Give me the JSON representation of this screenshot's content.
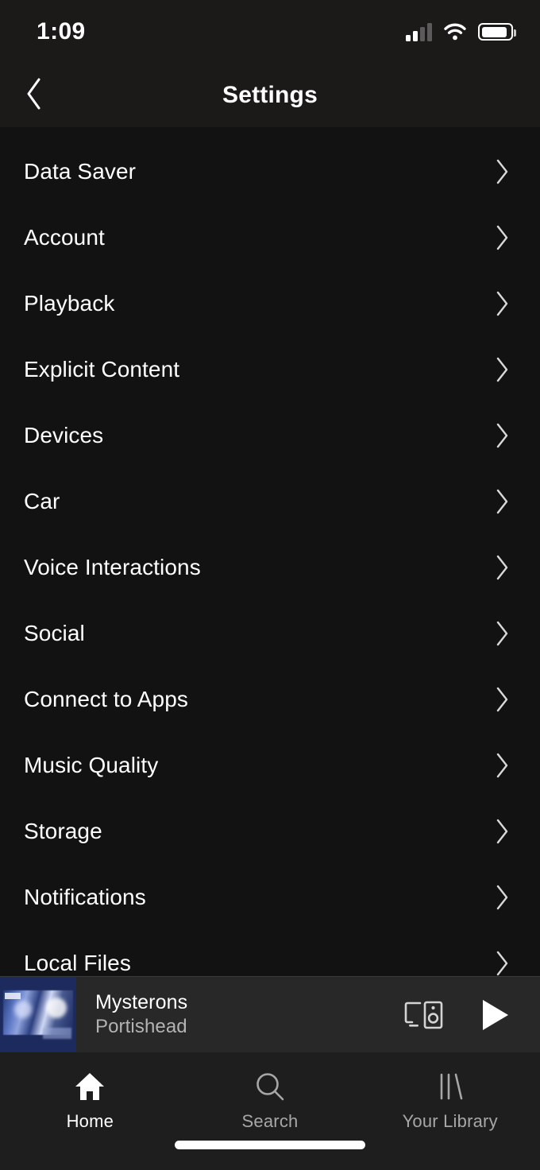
{
  "status_bar": {
    "time": "1:09",
    "signal_icon": "cellular-signal-icon",
    "signal_bars_total": 4,
    "signal_bars_filled": 2,
    "wifi_icon": "wifi-icon",
    "battery_icon": "battery-icon",
    "battery_level_percent": 90
  },
  "header": {
    "back_icon": "chevron-left-icon",
    "title": "Settings"
  },
  "settings": {
    "items": [
      {
        "label": "Data Saver",
        "chevron": "chevron-right-icon"
      },
      {
        "label": "Account",
        "chevron": "chevron-right-icon"
      },
      {
        "label": "Playback",
        "chevron": "chevron-right-icon"
      },
      {
        "label": "Explicit Content",
        "chevron": "chevron-right-icon"
      },
      {
        "label": "Devices",
        "chevron": "chevron-right-icon"
      },
      {
        "label": "Car",
        "chevron": "chevron-right-icon"
      },
      {
        "label": "Voice Interactions",
        "chevron": "chevron-right-icon"
      },
      {
        "label": "Social",
        "chevron": "chevron-right-icon"
      },
      {
        "label": "Connect to Apps",
        "chevron": "chevron-right-icon"
      },
      {
        "label": "Music Quality",
        "chevron": "chevron-right-icon"
      },
      {
        "label": "Storage",
        "chevron": "chevron-right-icon"
      },
      {
        "label": "Notifications",
        "chevron": "chevron-right-icon"
      },
      {
        "label": "Local Files",
        "chevron": "chevron-right-icon"
      }
    ]
  },
  "now_playing": {
    "album_art": "album-art-thumbnail",
    "track_title": "Mysterons",
    "artist": "Portishead",
    "connect_icon": "spotify-connect-devices-icon",
    "play_icon": "play-icon",
    "is_playing": false
  },
  "tab_bar": {
    "tabs": [
      {
        "label": "Home",
        "icon": "home-icon",
        "active": true
      },
      {
        "label": "Search",
        "icon": "search-icon",
        "active": false
      },
      {
        "label": "Your Library",
        "icon": "library-icon",
        "active": false
      }
    ]
  },
  "colors": {
    "app_background": "#121212",
    "header_background": "#1b1a19",
    "player_background": "#282828",
    "tabbar_background": "#1e1e1e",
    "primary_text": "#ffffff",
    "secondary_text": "#b3b3b3",
    "album_art_blue": "#1c2a5e"
  }
}
